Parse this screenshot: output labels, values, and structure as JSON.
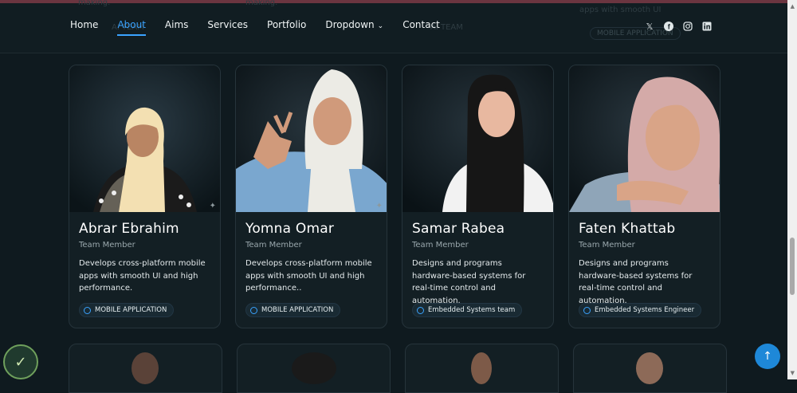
{
  "header": {
    "ghost_text": [
      "making.",
      "making.",
      "apps with smooth UI",
      "AI TEAM",
      "AI TEAM",
      "MOBILE APPLICATION"
    ],
    "nav": [
      {
        "label": "Home",
        "active": false
      },
      {
        "label": "About",
        "active": true
      },
      {
        "label": "Aims",
        "active": false
      },
      {
        "label": "Services",
        "active": false
      },
      {
        "label": "Portfolio",
        "active": false
      },
      {
        "label": "Dropdown",
        "active": false,
        "has_submenu": true
      },
      {
        "label": "Contact",
        "active": false
      }
    ],
    "social_icons": [
      "x-icon",
      "facebook-icon",
      "instagram-icon",
      "linkedin-icon"
    ]
  },
  "team": [
    {
      "name": "Abrar Ebrahim",
      "role": "Team Member",
      "description": "Develops cross-platform mobile apps with smooth UI and high performance.",
      "badge": "MOBILE APPLICATION"
    },
    {
      "name": "Yomna Omar",
      "role": "Team Member",
      "description": "Develops cross-platform mobile apps with smooth UI and high performance..",
      "badge": "MOBILE APPLICATION"
    },
    {
      "name": "Samar Rabea",
      "role": "Team Member",
      "description": "Designs and programs hardware-based systems for real-time control and automation.",
      "badge": "Embedded Systems team"
    },
    {
      "name": "Faten Khattab",
      "role": "Team Member",
      "description": "Designs and programs hardware-based systems for real-time control and automation.",
      "badge": "Embedded Systems Engineer"
    }
  ],
  "colors": {
    "accent": "#3aa3ff",
    "background": "#0f1a1f",
    "card": "#131f24"
  }
}
